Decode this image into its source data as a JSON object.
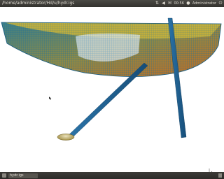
{
  "window": {
    "title": "/home/administrator/Hd/u/hydr.igs"
  },
  "tray": {
    "clock": "00:56",
    "user": "Administrator",
    "icons": [
      "network-icon",
      "volume-icon",
      "mail-icon",
      "battery-icon"
    ]
  },
  "viewport": {
    "background": "#ffffff",
    "hull_mesh_color": "#1a6f9e",
    "hull_fill_color": "#b8a033",
    "strut_color": "#1f5f8f",
    "bulb_color": "#c9b96a"
  },
  "taskbar": {
    "task_label": "hydr.igs"
  }
}
